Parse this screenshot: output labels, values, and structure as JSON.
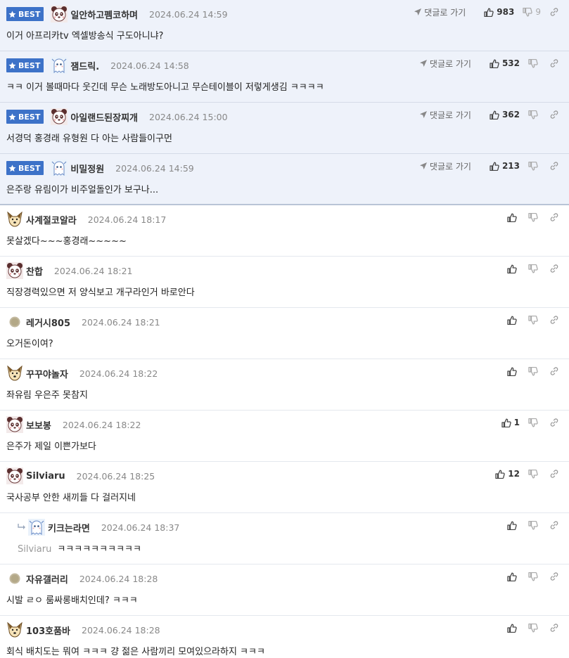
{
  "ui": {
    "best_label": "BEST",
    "goto_label": "댓글로 가기"
  },
  "best_comments": [
    {
      "nick": "일안하고펨코하며",
      "date": "2024.06.24 14:59",
      "text": "이거 아프리카tv 엑셀방송식 구도아니냐?",
      "likes": "983",
      "dislikes": "9",
      "avatar": "panda"
    },
    {
      "nick": "잼드릭.",
      "date": "2024.06.24 14:58",
      "text": "ㅋㅋ 이거 볼때마다 웃긴데 무슨 노래방도아니고 무슨테이블이 저렇게생김 ㅋㅋㅋㅋ",
      "likes": "532",
      "dislikes": "",
      "avatar": "ghost"
    },
    {
      "nick": "아일랜드된장찌개",
      "date": "2024.06.24 15:00",
      "text": "서경덕 홍경래 유형원 다 아는 사람들이구먼",
      "likes": "362",
      "dislikes": "",
      "avatar": "panda"
    },
    {
      "nick": "비밀정원",
      "date": "2024.06.24 14:59",
      "text": "은주랑 유림이가 비주얼돌인가 보구나...",
      "likes": "213",
      "dislikes": "",
      "avatar": "ghost"
    }
  ],
  "comments": [
    {
      "nick": "사계절코알라",
      "date": "2024.06.24 18:17",
      "text": "못살겠다~~~홍경래~~~~~",
      "likes": "",
      "avatar": "dog",
      "reply": false,
      "mention": ""
    },
    {
      "nick": "찬합",
      "date": "2024.06.24 18:21",
      "text": "직장경력있으면 저 양식보고 개구라인거 바로안다",
      "likes": "",
      "avatar": "panda",
      "reply": false,
      "mention": ""
    },
    {
      "nick": "레거시805",
      "date": "2024.06.24 18:21",
      "text": "오거돈이여?",
      "likes": "",
      "avatar": "dot",
      "reply": false,
      "mention": ""
    },
    {
      "nick": "꾸꾸야놀자",
      "date": "2024.06.24 18:22",
      "text": "좌유림 우은주 못참지",
      "likes": "",
      "avatar": "dog",
      "reply": false,
      "mention": ""
    },
    {
      "nick": "보보봉",
      "date": "2024.06.24 18:22",
      "text": "은주가 제일 이쁜가보다",
      "likes": "1",
      "avatar": "panda",
      "reply": false,
      "mention": ""
    },
    {
      "nick": "Silviaru",
      "date": "2024.06.24 18:25",
      "text": "국사공부 안한 새끼들 다 걸러지네",
      "likes": "12",
      "avatar": "panda",
      "reply": false,
      "mention": ""
    },
    {
      "nick": "키크는라면",
      "date": "2024.06.24 18:37",
      "text": "ㅋㅋㅋㅋㅋㅋㅋㅋㅋㅋ",
      "likes": "",
      "avatar": "ghost",
      "reply": true,
      "mention": "Silviaru"
    },
    {
      "nick": "자유갤러리",
      "date": "2024.06.24 18:28",
      "text": "시발 ㄹㅇ 룸싸롱배치인데? ㅋㅋㅋ",
      "likes": "",
      "avatar": "dot",
      "reply": false,
      "mention": ""
    },
    {
      "nick": "103호품바",
      "date": "2024.06.24 18:28",
      "text": "회식 배치도는 뭐여 ㅋㅋㅋ 걍 젊은 사람끼리 모여있으라하지 ㅋㅋㅋ",
      "likes": "",
      "avatar": "dog",
      "reply": false,
      "mention": ""
    }
  ]
}
